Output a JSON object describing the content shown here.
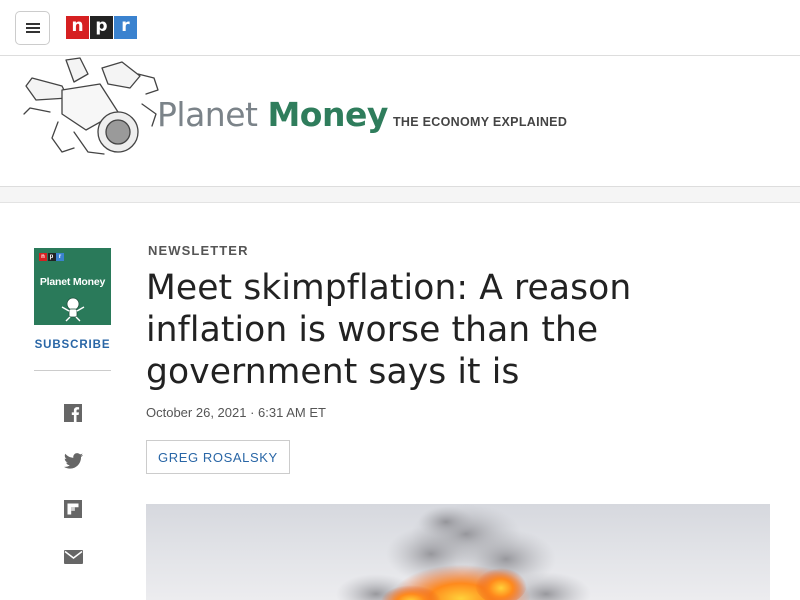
{
  "nav": {
    "menu_icon": "hamburger-icon",
    "logo": {
      "n": "n",
      "p": "p",
      "r": "r",
      "colors": {
        "n": "#d62021",
        "p": "#222222",
        "r": "#3a82cf"
      }
    }
  },
  "brand": {
    "title_part1": "Planet",
    "title_part2": "Money",
    "tagline": "THE ECONOMY EXPLAINED",
    "accent": "#2f7d5c"
  },
  "rail": {
    "podcast_tile": {
      "npr": [
        "n",
        "p",
        "r"
      ],
      "title": "Planet Money",
      "background": "#2a7a5a"
    },
    "subscribe_label": "SUBSCRIBE",
    "share_icons": [
      "facebook-icon",
      "twitter-icon",
      "flipboard-icon",
      "email-icon"
    ]
  },
  "article": {
    "kicker": "NEWSLETTER",
    "headline": "Meet skimpflation: A reason inflation is worse than the government says it is",
    "date": "October 26, 2021 · 6:31 AM ET",
    "byline": "GREG ROSALSKY",
    "link_color": "#2966a6"
  }
}
